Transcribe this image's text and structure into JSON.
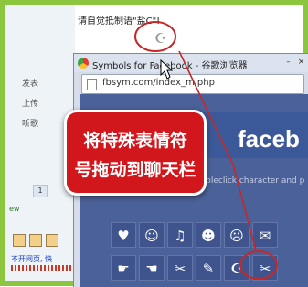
{
  "chat": {
    "instruction": "请自觉抵制语\"盐C\"!",
    "dragged_glyph": "☪"
  },
  "left_panel": {
    "links": [
      "发表",
      "上传",
      "听歌"
    ],
    "badge": "1",
    "fragment_ew": "ew",
    "status_text": "不开网页, 快",
    "icons": [
      "mail-icon",
      "window-icon",
      "doc-icon"
    ]
  },
  "browser": {
    "title": "Symbols for Facebook - 谷歌浏览器",
    "url": "fbsym.com/index_m.php",
    "window_buttons": [
      "–",
      "×"
    ]
  },
  "page": {
    "brand": "faceb",
    "hint": "Doubleclick character and p",
    "symbols_row1": [
      "♥",
      "☺",
      "♫",
      "☻",
      "☹",
      "✉"
    ],
    "symbols_row2": [
      "☛",
      "☚",
      "✂",
      "✎",
      "☪",
      "✂"
    ]
  },
  "callout": {
    "line1": "将特殊表情符",
    "line2": "号拖动到聊天栏"
  },
  "colors": {
    "frame": "#8cc63f",
    "facebook_blue": "#3b5998",
    "callout_red": "#d2171c",
    "highlight_circle": "#c62828"
  }
}
